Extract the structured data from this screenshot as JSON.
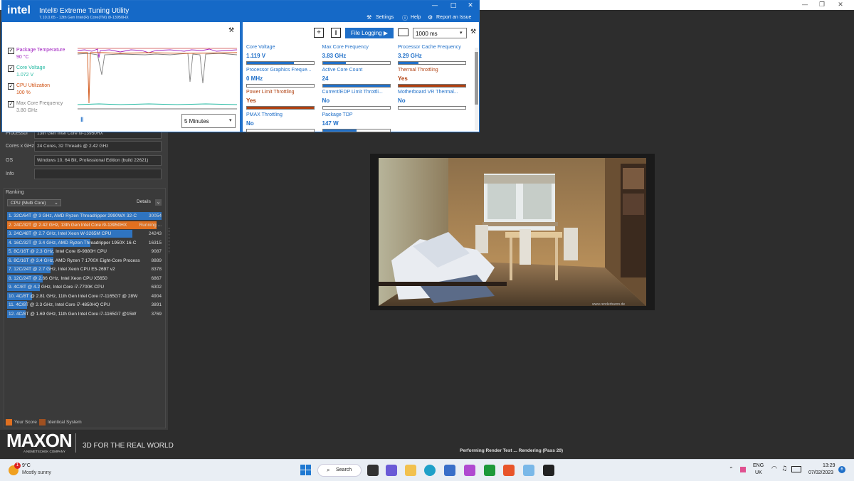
{
  "cinebench": {
    "info": [
      {
        "label": "Processor",
        "value": "13th Gen Intel Core i9-13950HX"
      },
      {
        "label": "Cores x GHz",
        "value": "24 Cores, 32 Threads @ 2.42 GHz"
      },
      {
        "label": "OS",
        "value": "Windows 10, 64 Bit, Professional Edition (build 22621)"
      },
      {
        "label": "Info",
        "value": ""
      }
    ],
    "ranking_title": "Ranking",
    "ranking_dropdown": "CPU (Multi Core)",
    "details_label": "Details",
    "rankings": [
      {
        "label": "1. 32C/64T @ 3 GHz, AMD Ryzen Threadripper 2990WX 32-C",
        "score": "30054",
        "fraction": 1.0,
        "color": "#2f74c0"
      },
      {
        "label": "2. 24C/32T @ 2.42 GHz, 13th Gen Intel Core i9-13950HX",
        "score": "Running ...",
        "fraction": 0.97,
        "color": "#e07020"
      },
      {
        "label": "3. 24C/48T @ 2.7 GHz, Intel Xeon W-3265M CPU",
        "score": "24243",
        "fraction": 0.81,
        "color": "#2f74c0"
      },
      {
        "label": "4. 16C/32T @ 3.4 GHz, AMD Ryzen Threadripper 1950X 16-C",
        "score": "16315",
        "fraction": 0.54,
        "color": "#2f74c0"
      },
      {
        "label": "5. 8C/16T @ 2.3 GHz, Intel Core i9-9880H CPU",
        "score": "9087",
        "fraction": 0.3,
        "color": "#2f74c0"
      },
      {
        "label": "6. 8C/16T @ 3.4 GHz, AMD Ryzen 7 1700X Eight-Core Process",
        "score": "8889",
        "fraction": 0.3,
        "color": "#2f74c0"
      },
      {
        "label": "7. 12C/24T @ 2.7 GHz, Intel Xeon CPU E5-2697 v2",
        "score": "8378",
        "fraction": 0.28,
        "color": "#2f74c0"
      },
      {
        "label": "8. 12C/24T @ 2.66 GHz, Intel Xeon CPU X5650",
        "score": "6867",
        "fraction": 0.23,
        "color": "#2f74c0"
      },
      {
        "label": "9. 4C/8T @ 4.2 GHz, Intel Core i7-7700K CPU",
        "score": "6302",
        "fraction": 0.21,
        "color": "#2f74c0"
      },
      {
        "label": "10. 4C/8T @ 2.81 GHz, 11th Gen Intel Core i7-1165G7 @ 28W",
        "score": "4904",
        "fraction": 0.16,
        "color": "#2f74c0"
      },
      {
        "label": "11. 4C/8T @ 2.3 GHz, Intel Core i7-4850HQ CPU",
        "score": "3891",
        "fraction": 0.13,
        "color": "#2f74c0"
      },
      {
        "label": "12. 4C/8T @ 1.69 GHz, 11th Gen Intel Core i7-1165G7 @15W",
        "score": "3769",
        "fraction": 0.12,
        "color": "#2f74c0"
      }
    ],
    "legend_your_score": "Your Score",
    "legend_identical": "Identical System",
    "maxon_logo": "MAXON",
    "maxon_sub": "A NEMETSCHEK COMPANY",
    "tagline": "3D FOR THE REAL WORLD",
    "status": "Performing Render Test ... Rendering (Pass 20)",
    "render_watermark": "www.renderbaron.de"
  },
  "xtu": {
    "logo": "intel",
    "title": "Intel® Extreme Tuning Utility",
    "subtitle": "7.10.0.65 - 13th Gen Intel(R) Core(TM) i9-13950HX",
    "settings": "Settings",
    "help": "Help",
    "report": "Report an Issue",
    "legend": [
      {
        "name": "Package Temperature",
        "value": "90 °C",
        "color": "#a020c0"
      },
      {
        "name": "Core Voltage",
        "value": "1.072 V",
        "color": "#20b8a0"
      },
      {
        "name": "CPU Utilization",
        "value": "100 %",
        "color": "#d05010"
      },
      {
        "name": "Max Core Frequency",
        "value": "3.80 GHz",
        "color": "#808080"
      }
    ],
    "time_range": "5 Minutes",
    "file_logging": "File Logging ▶",
    "interval": "1000 ms",
    "tiles": [
      {
        "label": "Core Voltage",
        "value": "1.119 V",
        "level": 0.7,
        "color": "#1f6fc8",
        "label_color": "#1f6fc8"
      },
      {
        "label": "Max Core Frequency",
        "value": "3.83 GHz",
        "level": 0.35,
        "color": "#1f6fc8",
        "label_color": "#1f6fc8"
      },
      {
        "label": "Processor Cache Frequency",
        "value": "3.29 GHz",
        "level": 0.3,
        "color": "#1f6fc8",
        "label_color": "#1f6fc8"
      },
      {
        "label": "Processor Graphics Freque...",
        "value": "0 MHz",
        "level": 0.0,
        "color": "#1f6fc8",
        "label_color": "#1f6fc8"
      },
      {
        "label": "Active Core Count",
        "value": "24",
        "level": 1.0,
        "color": "#1f6fc8",
        "label_color": "#1f6fc8"
      },
      {
        "label": "Thermal Throttling",
        "value": "Yes",
        "level": 1.0,
        "color": "#b04010",
        "label_color": "#b04010"
      },
      {
        "label": "Power Limit Throttling",
        "value": "Yes",
        "level": 1.0,
        "color": "#b04010",
        "label_color": "#b04010"
      },
      {
        "label": "Current/EDP Limit Throttli...",
        "value": "No",
        "level": 0.0,
        "color": "#1f6fc8",
        "label_color": "#1f6fc8"
      },
      {
        "label": "Motherboard VR Thermal...",
        "value": "No",
        "level": 0.0,
        "color": "#1f6fc8",
        "label_color": "#1f6fc8"
      },
      {
        "label": "PMAX Throttling",
        "value": "No",
        "level": 0.0,
        "color": "#1f6fc8",
        "label_color": "#1f6fc8"
      },
      {
        "label": "Package TDP",
        "value": "147 W",
        "level": 0.5,
        "color": "#1f6fc8",
        "label_color": "#1f6fc8"
      }
    ]
  },
  "taskbar": {
    "weather_temp": "9°C",
    "weather_desc": "Mostly sunny",
    "weather_badge": "1",
    "search": "Search",
    "lang": "ENG",
    "region": "UK",
    "time": "13:29",
    "date": "07/02/2023",
    "notif_count": "6"
  }
}
